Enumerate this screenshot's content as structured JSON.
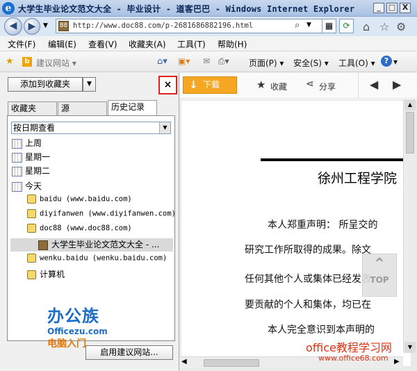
{
  "window": {
    "title": "大学生毕业论文范文大全 - 毕业设计 - 道客巴巴 - Windows Internet Explorer",
    "min_label": "_",
    "max_label": "□",
    "close_label": "X"
  },
  "address_bar": {
    "url": "http://www.doc88.com/p-2681686882196.html"
  },
  "menu": {
    "items": [
      "文件(F)",
      "编辑(E)",
      "查看(V)",
      "收藏夹(A)",
      "工具(T)",
      "帮助(H)"
    ]
  },
  "command_bar": {
    "suggested_sites": "建议网站 ▾",
    "page": "页面(P) ▾",
    "safety": "安全(S) ▾",
    "tools": "工具(O) ▾",
    "help": "▾"
  },
  "favorites_pane": {
    "add_button": "添加到收藏夹",
    "close_label": "×",
    "tabs": [
      "收藏夹",
      "源",
      "历史记录"
    ],
    "active_tab": "历史记录",
    "view_select": "按日期查看",
    "groups": [
      {
        "label": "上周"
      },
      {
        "label": "星期一"
      },
      {
        "label": "星期二"
      },
      {
        "label": "今天"
      }
    ],
    "sites": [
      {
        "label": "baidu (www.baidu.com)"
      },
      {
        "label": "diyifanwen (www.diyifanwen.com)"
      },
      {
        "label": "doc88 (www.doc88.com)"
      }
    ],
    "selected_page": "大学生毕业论文范文大全 - ...",
    "more_sites": [
      {
        "label": "wenku.baidu (wenku.baidu.com)"
      },
      {
        "label": "计算机"
      }
    ],
    "logo": {
      "top": "办公族",
      "mid": "Officezu.com",
      "bot": "电脑入门"
    },
    "enable_suggested_button": "启用建议网站..."
  },
  "page_toolbar": {
    "download": "下载",
    "favorite": "收藏",
    "share": "分享"
  },
  "document": {
    "heading": "徐州工程学院",
    "lines": [
      "本人郑重声明：  所呈交的",
      "研究工作所取得的成果。除文",
      "任何其他个人或集体已经发表",
      "要贡献的个人和集体，均已在",
      "本人完全意识到本声明的"
    ],
    "top_button": "TOP"
  },
  "watermark": {
    "line1": "office教程学习网",
    "line2": "www.office68.com"
  }
}
